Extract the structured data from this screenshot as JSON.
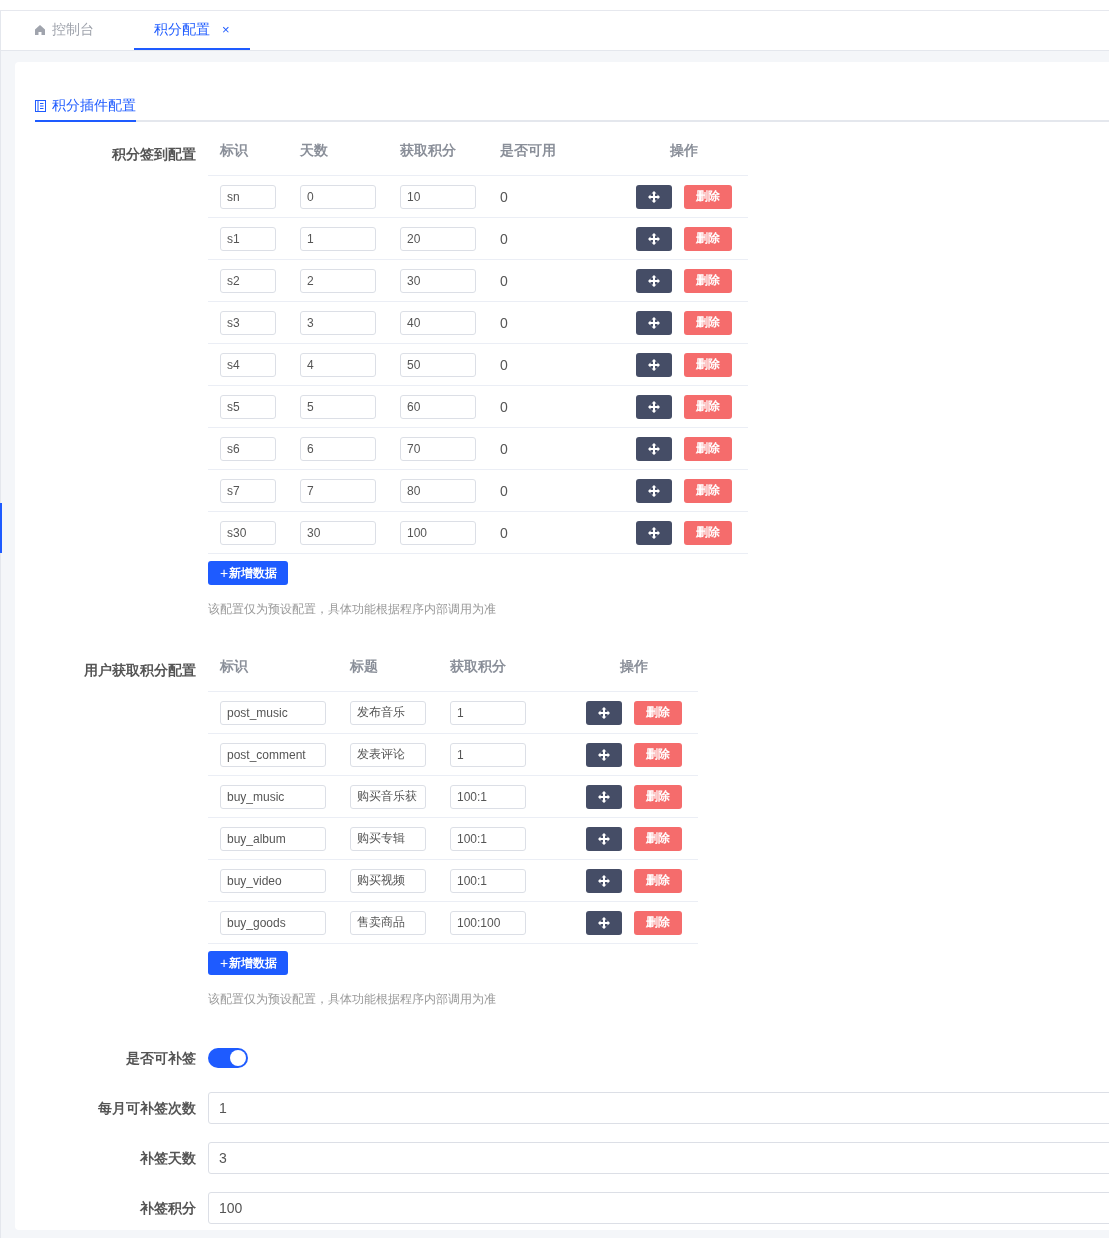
{
  "tabs": [
    {
      "kind": "home",
      "label": "控制台",
      "selected": false
    },
    {
      "kind": "closable",
      "label": "积分配置",
      "selected": true,
      "close": "×"
    }
  ],
  "card_tabs": [
    {
      "label": "积分插件配置",
      "selected": true
    }
  ],
  "sign_table": {
    "label": "积分签到配置",
    "columns": [
      "标识",
      "天数",
      "获取积分",
      "是否可用",
      "操作"
    ],
    "rows": [
      {
        "id": "sn",
        "days": "0",
        "points": "10",
        "usable": "0",
        "delete": "删除"
      },
      {
        "id": "s1",
        "days": "1",
        "points": "20",
        "usable": "0",
        "delete": "删除"
      },
      {
        "id": "s2",
        "days": "2",
        "points": "30",
        "usable": "0",
        "delete": "删除"
      },
      {
        "id": "s3",
        "days": "3",
        "points": "40",
        "usable": "0",
        "delete": "删除"
      },
      {
        "id": "s4",
        "days": "4",
        "points": "50",
        "usable": "0",
        "delete": "删除"
      },
      {
        "id": "s5",
        "days": "5",
        "points": "60",
        "usable": "0",
        "delete": "删除"
      },
      {
        "id": "s6",
        "days": "6",
        "points": "70",
        "usable": "0",
        "delete": "删除"
      },
      {
        "id": "s7",
        "days": "7",
        "points": "80",
        "usable": "0",
        "delete": "删除"
      },
      {
        "id": "s30",
        "days": "30",
        "points": "100",
        "usable": "0",
        "delete": "删除"
      }
    ],
    "add": "新增数据",
    "add_sign": "+",
    "note": "该配置仅为预设配置，具体功能根据程序内部调用为准"
  },
  "points_table": {
    "label": "用户获取积分配置",
    "columns": [
      "标识",
      "标题",
      "获取积分",
      "操作"
    ],
    "rows": [
      {
        "id": "post_music",
        "title": "发布音乐",
        "points": "1",
        "delete": "删除"
      },
      {
        "id": "post_comment",
        "title": "发表评论",
        "points": "1",
        "delete": "删除"
      },
      {
        "id": "buy_music",
        "title": "购买音乐获",
        "points": "100:1",
        "delete": "删除"
      },
      {
        "id": "buy_album",
        "title": "购买专辑",
        "points": "100:1",
        "delete": "删除"
      },
      {
        "id": "buy_video",
        "title": "购买视频",
        "points": "100:1",
        "delete": "删除"
      },
      {
        "id": "buy_goods",
        "title": "售卖商品",
        "points": "100:100",
        "delete": "删除"
      }
    ],
    "add": "新增数据",
    "add_sign": "+",
    "note": "该配置仅为预设配置，具体功能根据程序内部调用为准"
  },
  "form": [
    {
      "kind": "switch",
      "label": "是否可补签",
      "on": true
    },
    {
      "kind": "input",
      "label": "每月可补签次数",
      "value": "1"
    },
    {
      "kind": "input",
      "label": "补签天数",
      "value": "3"
    },
    {
      "kind": "input",
      "label": "补签积分",
      "value": "100"
    }
  ]
}
